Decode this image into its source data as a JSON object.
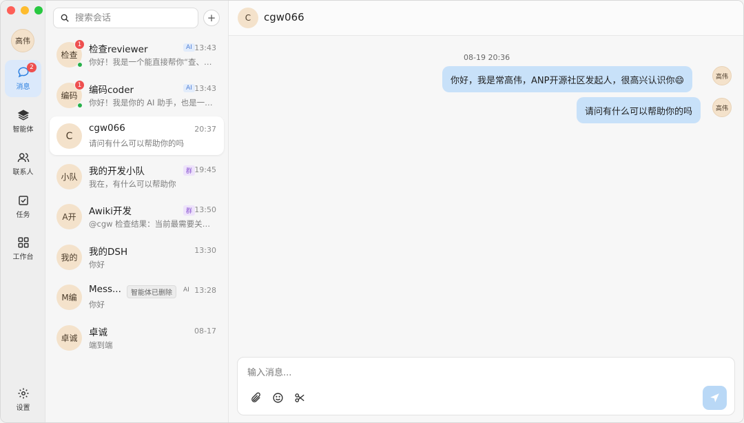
{
  "user": {
    "avatar_text": "高伟"
  },
  "nav": {
    "items": [
      {
        "label": "消息",
        "icon": "chat-bubble-icon",
        "badge": "2",
        "active": true
      },
      {
        "label": "智能体",
        "icon": "layers-icon"
      },
      {
        "label": "联系人",
        "icon": "contacts-icon"
      },
      {
        "label": "任务",
        "icon": "checkbox-icon"
      },
      {
        "label": "工作台",
        "icon": "grid-icon"
      }
    ],
    "settings_label": "设置"
  },
  "search": {
    "placeholder": "搜索会话"
  },
  "conversations": [
    {
      "avatar": "检查",
      "name": "检查reviewer",
      "tag": "AI",
      "time": "13:43",
      "preview": "你好！我是一个能直接帮你“查、…",
      "badge": "1",
      "online": true
    },
    {
      "avatar": "编码",
      "name": "编码coder",
      "tag": "AI",
      "time": "13:43",
      "preview": "你好！我是你的 AI 助手，也是一…",
      "badge": "1",
      "online": true
    },
    {
      "avatar": "C",
      "name": "cgw066",
      "time": "20:37",
      "preview": "请问有什么可以帮助你的吗",
      "active": true
    },
    {
      "avatar": "小队",
      "name": "我的开发小队",
      "tag": "群",
      "time": "19:45",
      "preview": "我在，有什么可以帮助你"
    },
    {
      "avatar": "A开",
      "name": "Awiki开发",
      "tag": "群",
      "time": "13:50",
      "preview": "@cgw 检查结果：当前最需要关…"
    },
    {
      "avatar": "我的",
      "name": "我的DSH",
      "time": "13:30",
      "preview": "你好"
    },
    {
      "avatar": "M编",
      "name": "Mess...",
      "tag_deleted": "智能体已删除",
      "tag": "AI",
      "time": "13:28",
      "preview": "你好"
    },
    {
      "avatar": "卓诚",
      "name": "卓诚",
      "time": "08-17",
      "preview": "端到端"
    }
  ],
  "chat": {
    "avatar": "C",
    "title": "cgw066",
    "timestamp": "08-19 20:36",
    "messages": [
      {
        "text": "你好，我是常高伟，ANP开源社区发起人，很高兴认识你😄",
        "sender_avatar": "高伟"
      },
      {
        "text": "请问有什么可以帮助你的吗",
        "sender_avatar": "高伟"
      }
    ],
    "composer_placeholder": "输入消息...",
    "tools": [
      "paperclip-icon",
      "smiley-icon",
      "scissors-icon"
    ]
  },
  "colors": {
    "accent": "#2b7fe0",
    "bubble": "#c8e1f9",
    "badge": "#ee4f4f",
    "online": "#27b04a",
    "avatar_bg": "#f4e2cb"
  }
}
